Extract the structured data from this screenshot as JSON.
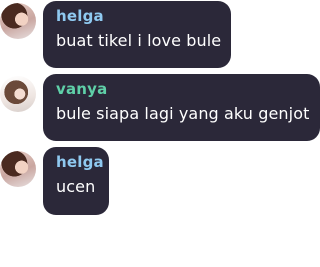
{
  "messages": [
    {
      "author": "helga",
      "text": "buat tikel i love bule",
      "name_color": "#8fc9f0",
      "avatar": "helga-avatar"
    },
    {
      "author": "vanya",
      "text": "bule siapa lagi yang aku genjot",
      "name_color": "#5fd0a8",
      "avatar": "vanya-avatar"
    },
    {
      "author": "helga",
      "text": "ucen",
      "name_color": "#8fc9f0",
      "avatar": "helga-avatar"
    }
  ],
  "colors": {
    "bubble_bg": "#2b2839",
    "message_text": "#ffffff"
  }
}
